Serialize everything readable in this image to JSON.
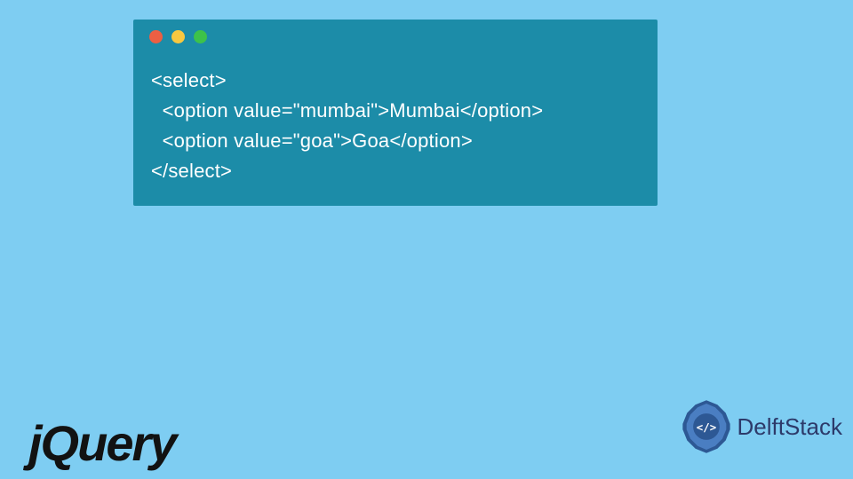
{
  "code": {
    "lines": [
      "<select>",
      "  <option value=\"mumbai\">Mumbai</option>",
      "  <option value=\"goa\">Goa</option>",
      "</select>"
    ]
  },
  "logos": {
    "jquery": "jQuery",
    "delftstack": "DelftStack",
    "delftstack_glyph": "</>"
  },
  "colors": {
    "background": "#7ecdf2",
    "window": "#1c8ca8",
    "dot_red": "#ec5f43",
    "dot_yellow": "#f8c840",
    "dot_green": "#3dc24a",
    "logo_blue": "#2d3a6a"
  }
}
